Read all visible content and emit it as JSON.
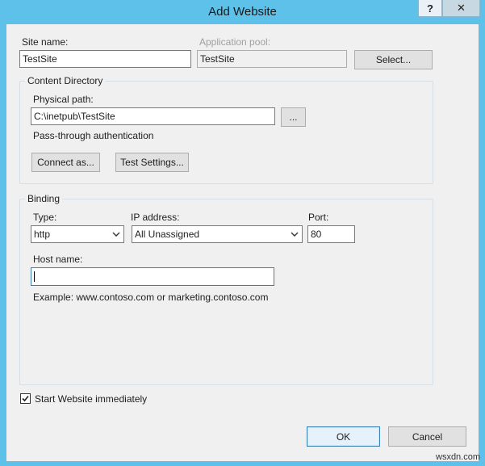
{
  "window": {
    "title": "Add Website",
    "help_glyph": "?",
    "close_glyph": "✕"
  },
  "site": {
    "site_name_label": "Site name:",
    "site_name_value": "TestSite",
    "app_pool_label": "Application pool:",
    "app_pool_value": "TestSite",
    "select_button": "Select..."
  },
  "content_directory": {
    "title": "Content Directory",
    "physical_path_label": "Physical path:",
    "physical_path_value": "C:\\inetpub\\TestSite",
    "browse_button": "...",
    "auth_text": "Pass-through authentication",
    "connect_as_button": "Connect as...",
    "test_settings_button": "Test Settings..."
  },
  "binding": {
    "title": "Binding",
    "type_label": "Type:",
    "type_value": "http",
    "ip_label": "IP address:",
    "ip_value": "All Unassigned",
    "port_label": "Port:",
    "port_value": "80",
    "host_label": "Host name:",
    "host_value": "",
    "example_text": "Example: www.contoso.com or marketing.contoso.com"
  },
  "start_immediately": {
    "label": "Start Website immediately",
    "checked": true
  },
  "footer": {
    "ok_button": "OK",
    "cancel_button": "Cancel"
  },
  "watermark": "wsxdn.com",
  "colors": {
    "titlebar": "#5dc1ea",
    "dialog_bg": "#f0f0f0",
    "focus_border": "#3c7fb1"
  }
}
